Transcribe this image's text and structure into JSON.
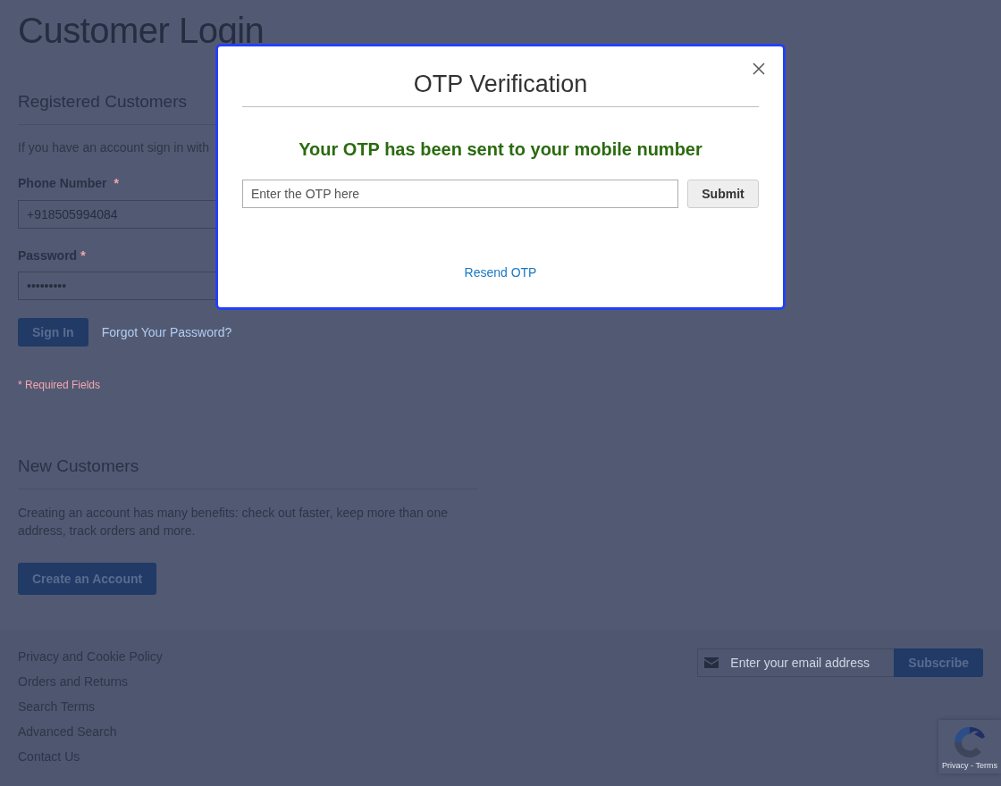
{
  "page": {
    "title": "Customer Login"
  },
  "registered": {
    "heading": "Registered Customers",
    "intro": "If you have an account sign in with",
    "fields": [
      {
        "label": "Phone Number",
        "required_mark": "*",
        "value": "+918505994084"
      },
      {
        "label": "Password",
        "required_mark": "*",
        "value": "•••••••••"
      }
    ],
    "sign_in_button": "Sign In",
    "forgot_link": "Forgot Your Password?",
    "required_note": "* Required Fields"
  },
  "new_customers": {
    "heading": "New Customers",
    "text": "Creating an account has many benefits: check out faster, keep more than one address, track orders and more.",
    "create_button": "Create an Account"
  },
  "footer": {
    "links": [
      "Privacy and Cookie Policy",
      "Orders and Returns",
      "Search Terms",
      "Advanced Search",
      "Contact Us"
    ],
    "newsletter": {
      "placeholder": "Enter your email address",
      "button": "Subscribe"
    }
  },
  "recaptcha": {
    "links": "Privacy - Terms"
  },
  "otp_modal": {
    "title": "OTP Verification",
    "message": "Your OTP has been sent to your mobile number",
    "otp_field": {
      "placeholder": "Enter the OTP here"
    },
    "submit_button": "Submit",
    "resend_link": "Resend OTP"
  }
}
